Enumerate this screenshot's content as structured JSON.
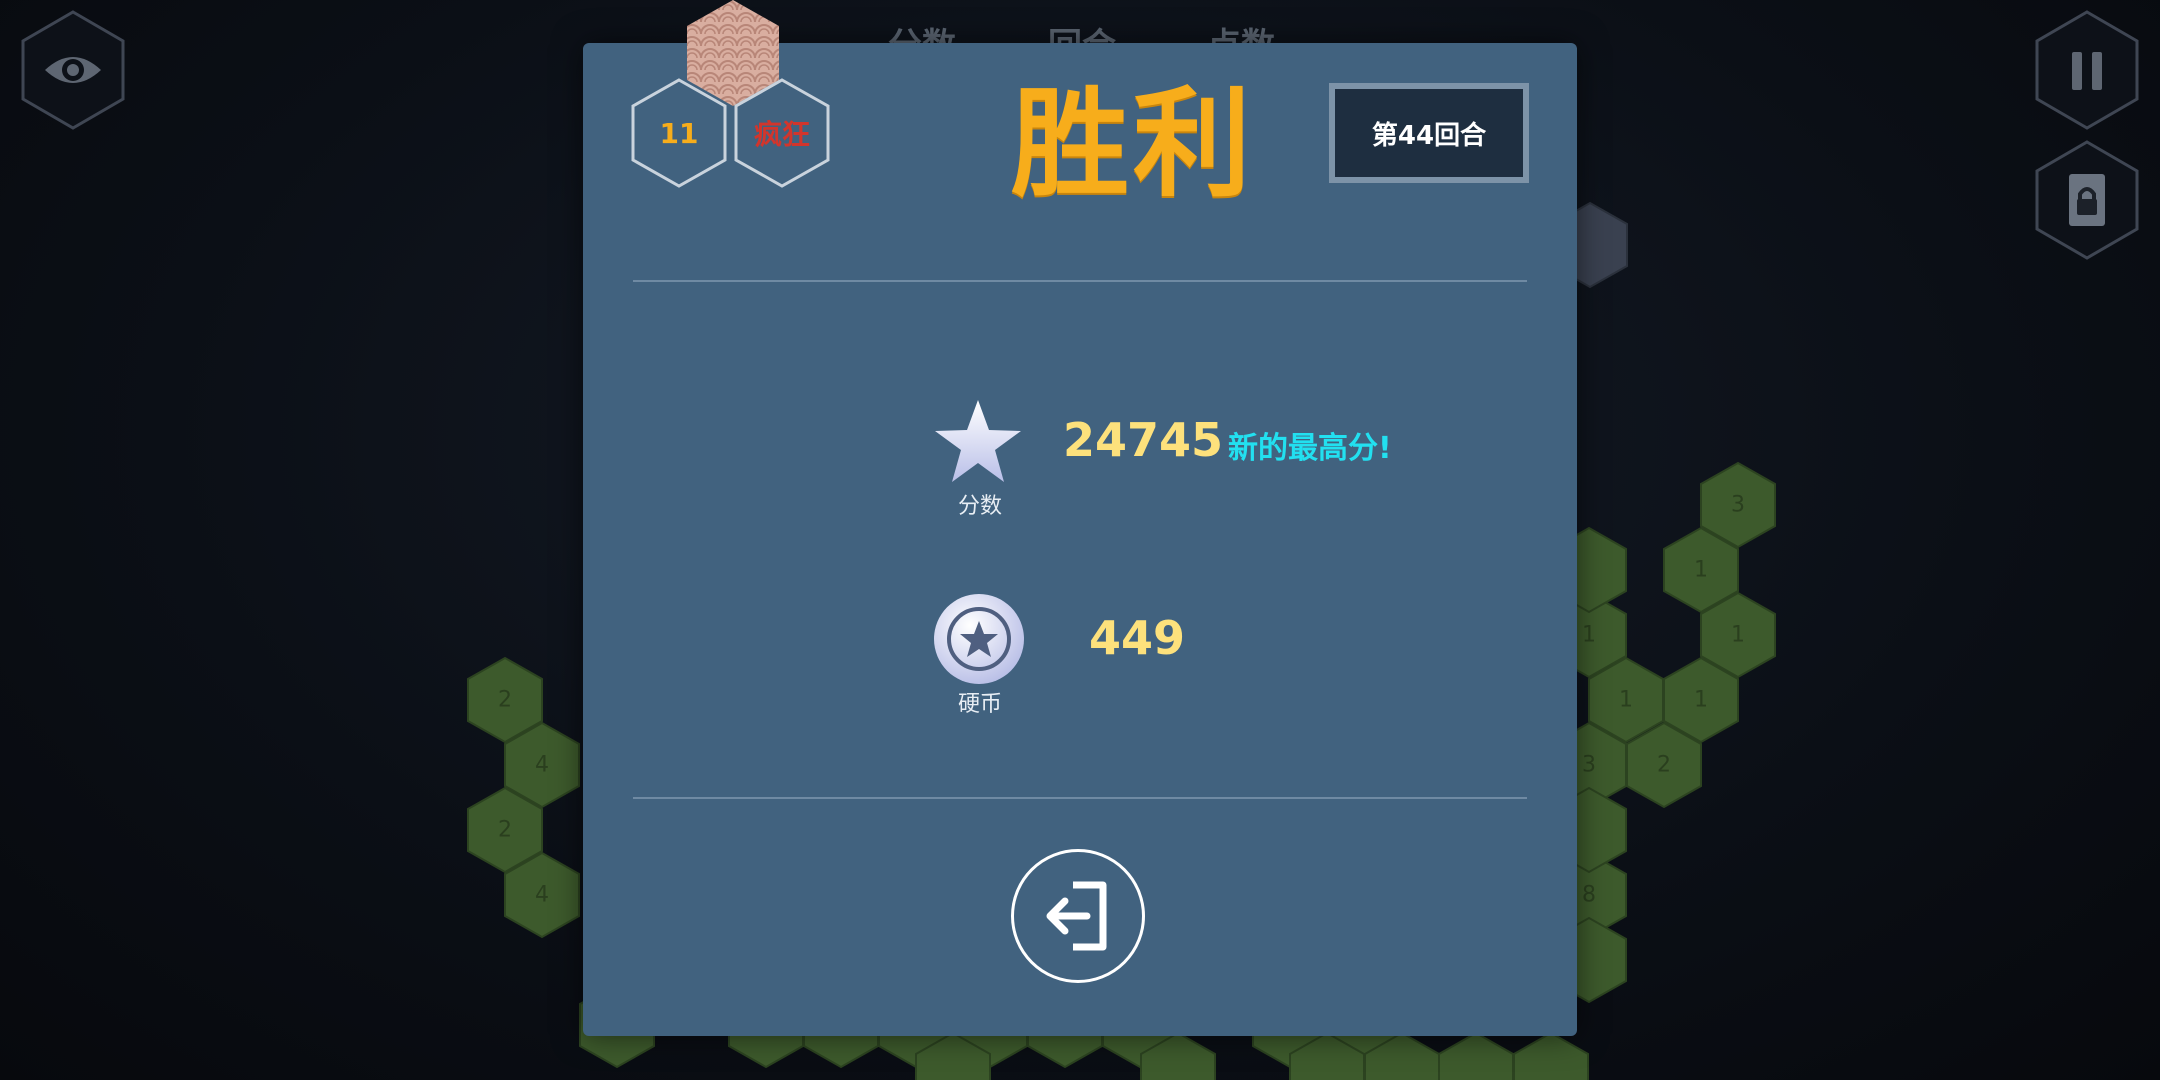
{
  "hud": {
    "score_label": "分数",
    "round_label": "回合",
    "points_label": "点数"
  },
  "board_cells": [
    "2",
    "4",
    "2",
    "4",
    "3",
    "1",
    "1",
    "1",
    "1",
    "1",
    "3",
    "2",
    "8"
  ],
  "dialog": {
    "badges": {
      "level_value": "11",
      "mode_label": "疯狂"
    },
    "title": "胜利",
    "round_text": "第44回合",
    "score": {
      "label": "分数",
      "value": "24745",
      "record_text": "新的最高分!"
    },
    "coins": {
      "label": "硬币",
      "value": "449"
    }
  },
  "colors": {
    "panel": "#41627f",
    "title": "#f7ad1b",
    "value": "#fde17c",
    "record": "#22e0f0",
    "board_cell": "#3d5a2c"
  },
  "icons": {
    "top_left": "eye-icon",
    "top_right": "pause-icon",
    "right_second": "lock-icon",
    "score": "star-icon",
    "coins": "coin-icon",
    "exit": "exit-icon"
  }
}
